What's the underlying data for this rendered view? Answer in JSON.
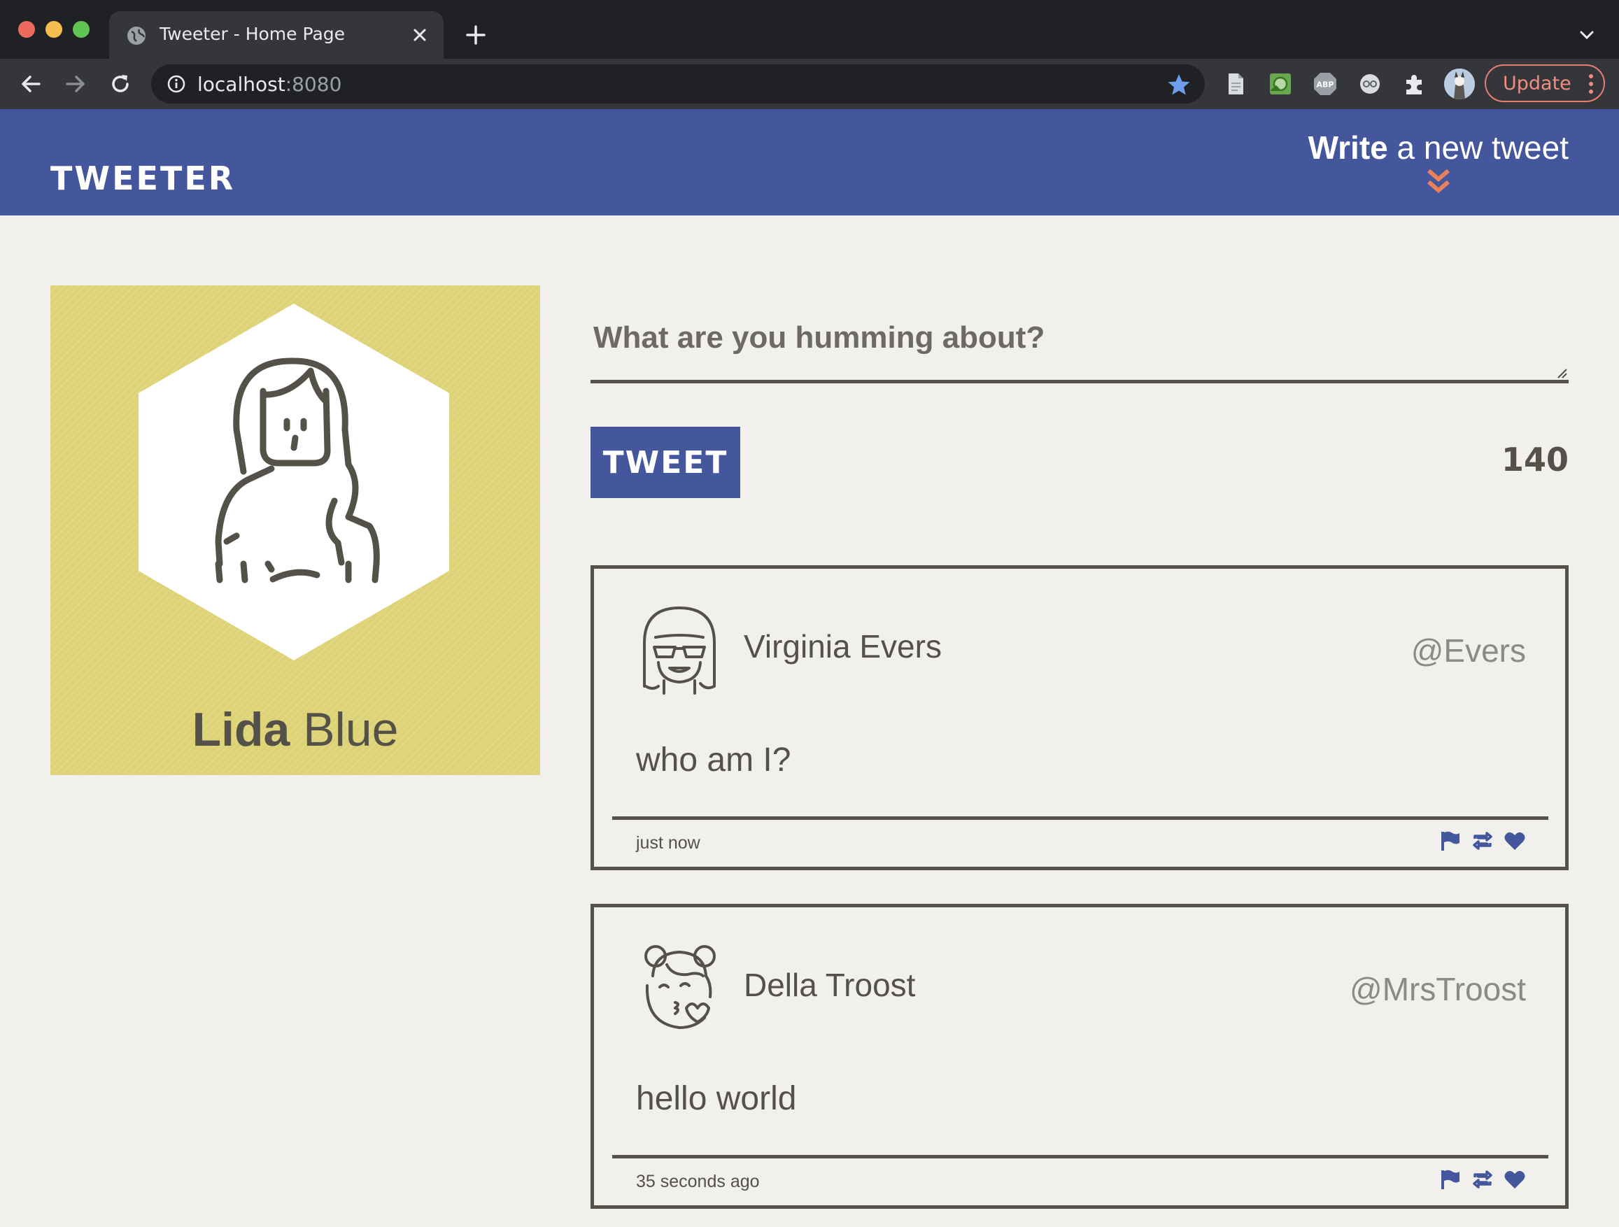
{
  "browser": {
    "tab_title": "Tweeter - Home Page",
    "url_host": "localhost",
    "url_port": ":8080",
    "update_label": "Update",
    "icons": [
      "back-icon",
      "forward-icon",
      "reload-icon",
      "info-icon",
      "bookmark-star-icon",
      "document-extension-icon",
      "photo-extension-icon",
      "adblock-extension-icon",
      "ghost-extension-icon",
      "puzzle-extensions-icon",
      "profile-avatar-icon",
      "more-menu-icon"
    ]
  },
  "header": {
    "brand": "TWEETER",
    "compose_bold": "Write",
    "compose_rest": " a new tweet",
    "accent_color": "#e8825a",
    "nav_color": "#44579c"
  },
  "profile": {
    "first_name": "Lida",
    "last_name": " Blue",
    "card_color": "#ddd275"
  },
  "composer": {
    "placeholder": "What are you humming about?",
    "button_label": "TWEET",
    "counter": "140"
  },
  "tweets": [
    {
      "name": "Virginia Evers",
      "handle": "@Evers",
      "text": "who am I?",
      "time": "just now"
    },
    {
      "name": "Della Troost",
      "handle": "@MrsTroost",
      "text": "hello world",
      "time": "35 seconds ago"
    }
  ]
}
